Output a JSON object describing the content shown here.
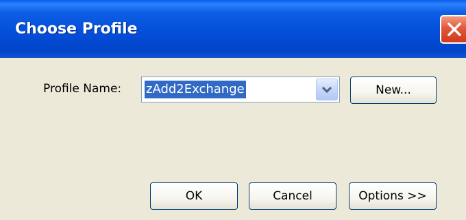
{
  "window": {
    "title": "Choose Profile"
  },
  "form": {
    "profile_label": "Profile Name:",
    "profile_value": "zAdd2Exchange",
    "new_button": "New..."
  },
  "buttons": {
    "ok": "OK",
    "cancel": "Cancel",
    "options": "Options >>"
  },
  "icons": {
    "close": "close-icon",
    "dropdown": "chevron-down-icon"
  },
  "colors": {
    "titlebar": "#0552dc",
    "close": "#e2583a",
    "client": "#ece9d8",
    "selection": "#316ac5"
  }
}
